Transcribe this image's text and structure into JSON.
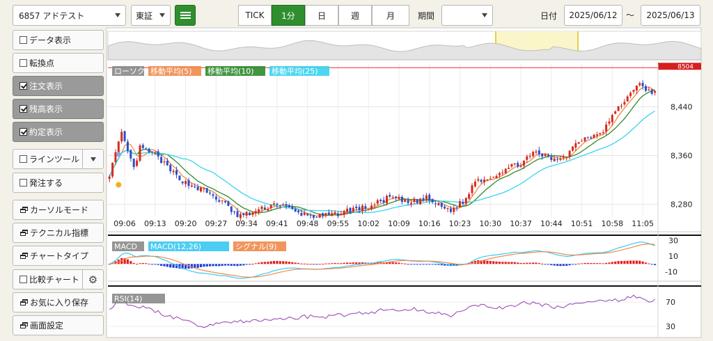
{
  "toolbar": {
    "symbol": "6857 アドテスト",
    "market": "東証",
    "intervals": [
      {
        "label": "TICK",
        "active": false
      },
      {
        "label": "1分",
        "active": true
      },
      {
        "label": "日",
        "active": false
      },
      {
        "label": "週",
        "active": false
      },
      {
        "label": "月",
        "active": false
      }
    ],
    "period_label": "期間",
    "period_value": "",
    "date_label": "日付",
    "date_from": "2025/06/12",
    "date_sep": "〜",
    "date_to": "2025/06/13"
  },
  "sidebar": {
    "items": [
      {
        "label": "データ表示",
        "kind": "checkbox",
        "checked": false
      },
      {
        "label": "転換点",
        "kind": "checkbox",
        "checked": false
      },
      {
        "label": "注文表示",
        "kind": "checkbox",
        "checked": true
      },
      {
        "label": "残高表示",
        "kind": "checkbox",
        "checked": true
      },
      {
        "label": "約定表示",
        "kind": "checkbox",
        "checked": true
      },
      {
        "label": "ラインツール",
        "kind": "checkbox-split",
        "checked": false
      },
      {
        "label": "発注する",
        "kind": "checkbox",
        "checked": false
      },
      {
        "label": "カーソルモード",
        "kind": "window"
      },
      {
        "label": "テクニカル指標",
        "kind": "window"
      },
      {
        "label": "チャートタイプ",
        "kind": "window"
      },
      {
        "label": "比較チャート",
        "kind": "checkbox-gear",
        "checked": false
      },
      {
        "label": "お気に入り保存",
        "kind": "window"
      },
      {
        "label": "画面設定",
        "kind": "window"
      }
    ]
  },
  "colors": {
    "accent_green": "#2f8f2f",
    "up": "#d52b1e",
    "down": "#2b4fc9",
    "ma5": "#f08a4b",
    "ma10": "#2e8b2e",
    "ma25": "#38d3f0",
    "macd": "#38c8f0",
    "signal": "#f08a4b",
    "rsi": "#9a4fb5"
  },
  "chart_data": [
    {
      "type": "candlestick",
      "title": "",
      "legend": [
        "ローソク",
        "移動平均(5)",
        "移動平均(10)",
        "移動平均(25)"
      ],
      "x_tick_labels": [
        "09:06",
        "09:13",
        "09:20",
        "09:27",
        "09:34",
        "09:41",
        "09:48",
        "09:55",
        "10:02",
        "10:09",
        "10:16",
        "10:23",
        "10:30",
        "10:37",
        "10:44",
        "10:51",
        "10:58",
        "11:05"
      ],
      "y_tick_labels": [
        "8,440",
        "8,360",
        "8,280"
      ],
      "ylim": [
        8235,
        8510
      ],
      "price_line": {
        "value": 8504,
        "label": "8504"
      },
      "close_anchors": [
        [
          0,
          8330
        ],
        [
          4,
          8395
        ],
        [
          8,
          8338
        ],
        [
          10,
          8372
        ],
        [
          15,
          8362
        ],
        [
          20,
          8335
        ],
        [
          25,
          8315
        ],
        [
          32,
          8300
        ],
        [
          38,
          8280
        ],
        [
          42,
          8260
        ],
        [
          46,
          8265
        ],
        [
          50,
          8272
        ],
        [
          55,
          8282
        ],
        [
          62,
          8265
        ],
        [
          68,
          8260
        ],
        [
          73,
          8262
        ],
        [
          80,
          8272
        ],
        [
          85,
          8275
        ],
        [
          92,
          8292
        ],
        [
          98,
          8282
        ],
        [
          104,
          8290
        ],
        [
          108,
          8278
        ],
        [
          112,
          8270
        ],
        [
          117,
          8288
        ],
        [
          120,
          8320
        ],
        [
          124,
          8322
        ],
        [
          130,
          8338
        ],
        [
          135,
          8348
        ],
        [
          140,
          8365
        ],
        [
          146,
          8352
        ],
        [
          150,
          8362
        ],
        [
          154,
          8385
        ],
        [
          158,
          8392
        ],
        [
          162,
          8402
        ],
        [
          166,
          8432
        ],
        [
          170,
          8455
        ],
        [
          173,
          8478
        ],
        [
          176,
          8468
        ],
        [
          179,
          8462
        ]
      ],
      "ma_lengths": [
        5,
        10,
        25
      ]
    },
    {
      "type": "bar-line",
      "legend": [
        "MACD",
        "MACD(12,26)",
        "シグナル(9)"
      ],
      "y_tick_labels": [
        "30",
        "10",
        "-10"
      ],
      "ylim": [
        -22,
        35
      ]
    },
    {
      "type": "line",
      "legend": [
        "RSI(14)"
      ],
      "y_tick_labels": [
        "70",
        "30"
      ],
      "ylim": [
        15,
        92
      ],
      "rsi_anchors": [
        [
          0,
          55
        ],
        [
          3,
          79
        ],
        [
          6,
          68
        ],
        [
          10,
          62
        ],
        [
          14,
          57
        ],
        [
          20,
          46
        ],
        [
          26,
          36
        ],
        [
          30,
          30
        ],
        [
          35,
          35
        ],
        [
          40,
          38
        ],
        [
          45,
          37
        ],
        [
          50,
          40
        ],
        [
          55,
          42
        ],
        [
          60,
          44
        ],
        [
          65,
          46
        ],
        [
          70,
          46
        ],
        [
          75,
          48
        ],
        [
          80,
          52
        ],
        [
          85,
          52
        ],
        [
          90,
          58
        ],
        [
          95,
          56
        ],
        [
          100,
          58
        ],
        [
          104,
          55
        ],
        [
          108,
          52
        ],
        [
          112,
          49
        ],
        [
          116,
          57
        ],
        [
          120,
          62
        ],
        [
          124,
          64
        ],
        [
          130,
          60
        ],
        [
          135,
          68
        ],
        [
          140,
          68
        ],
        [
          145,
          62
        ],
        [
          150,
          64
        ],
        [
          155,
          69
        ],
        [
          160,
          70
        ],
        [
          165,
          71
        ],
        [
          170,
          78
        ],
        [
          174,
          80
        ],
        [
          177,
          71
        ],
        [
          179,
          72
        ]
      ]
    }
  ]
}
